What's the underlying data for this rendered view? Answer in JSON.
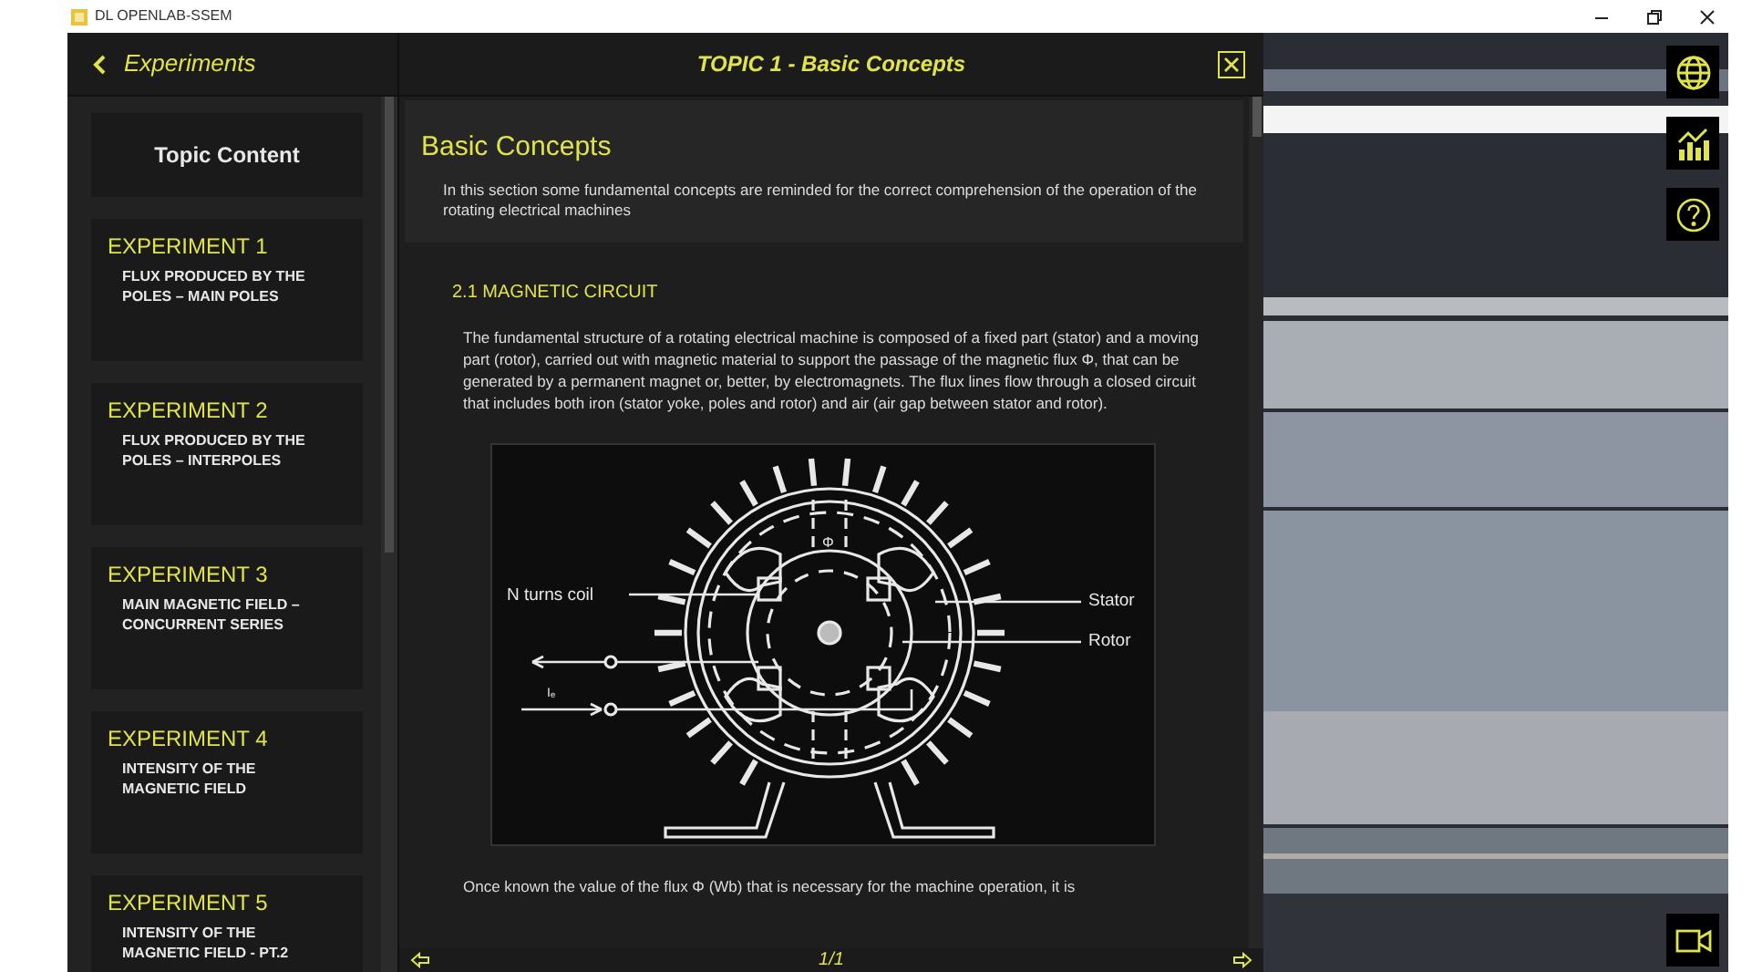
{
  "window": {
    "title": "DL OPENLAB-SSEM"
  },
  "sidebar": {
    "back_label": "Experiments",
    "topic_button": "Topic Content",
    "items": [
      {
        "title": "EXPERIMENT 1",
        "subtitle": "FLUX PRODUCED BY THE POLES – MAIN POLES"
      },
      {
        "title": "EXPERIMENT 2",
        "subtitle": "FLUX PRODUCED BY THE POLES – INTERPOLES"
      },
      {
        "title": "EXPERIMENT 3",
        "subtitle": "MAIN MAGNETIC FIELD – CONCURRENT SERIES"
      },
      {
        "title": "EXPERIMENT 4",
        "subtitle": "INTENSITY OF THE MAGNETIC FIELD"
      },
      {
        "title": "EXPERIMENT 5",
        "subtitle": "INTENSITY OF THE MAGNETIC FIELD - PT.2"
      }
    ]
  },
  "content": {
    "header_title": "TOPIC 1 - Basic Concepts",
    "heading": "Basic Concepts",
    "intro": "In this section some fundamental concepts are reminded for the correct comprehension of the operation of the rotating electrical machines",
    "section_title": "2.1 MAGNETIC CIRCUIT",
    "paragraph": "The fundamental structure of a rotating electrical machine is composed of a fixed part (stator) and a moving part (rotor), carried out with magnetic material to support the passage of the magnetic flux Φ, that can be generated by a permanent magnet or, better, by electromagnets. The flux lines flow through a closed circuit that includes both iron (stator yoke, poles and rotor) and air (air gap between stator and rotor).",
    "diagram_labels": {
      "coil": "N turns coil",
      "stator": "Stator",
      "rotor": "Rotor",
      "flux": "Φ",
      "current": "Iₑ"
    },
    "after_text": "Once known the value of the flux Φ (Wb) that is necessary for the machine operation, it is",
    "page_indicator": "1/1"
  }
}
